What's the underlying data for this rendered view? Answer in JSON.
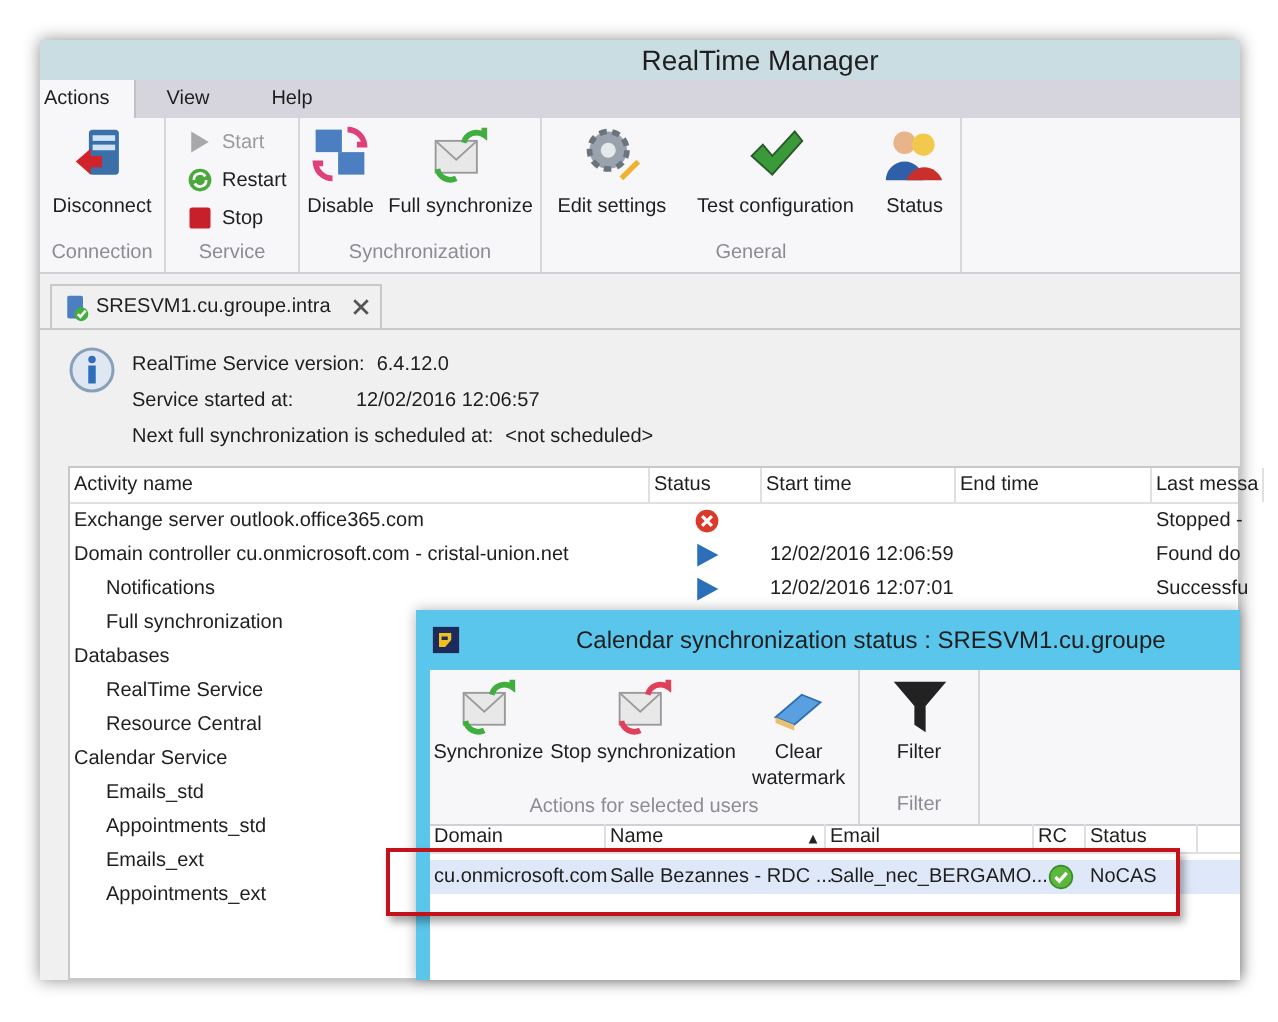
{
  "window": {
    "title": "RealTime Manager"
  },
  "menu_tabs": [
    {
      "label": "Actions",
      "selected": true
    },
    {
      "label": "View",
      "selected": false
    },
    {
      "label": "Help",
      "selected": false
    }
  ],
  "ribbon_groups": [
    {
      "label": "Connection",
      "buttons": [
        {
          "label": "Disconnect",
          "kind": "large",
          "disabled": false
        }
      ]
    },
    {
      "label": "Service",
      "buttons": [
        {
          "label": "Start",
          "kind": "small",
          "disabled": true
        },
        {
          "label": "Restart",
          "kind": "small",
          "disabled": false
        },
        {
          "label": "Stop",
          "kind": "small",
          "disabled": false
        }
      ]
    },
    {
      "label": "Synchronization",
      "buttons": [
        {
          "label": "Disable",
          "kind": "large",
          "disabled": false
        },
        {
          "label": "Full synchronize",
          "kind": "large",
          "disabled": false
        }
      ]
    },
    {
      "label": "General",
      "buttons": [
        {
          "label": "Edit settings",
          "kind": "large",
          "disabled": false
        },
        {
          "label": "Test configuration",
          "kind": "large",
          "disabled": false
        },
        {
          "label": "Status",
          "kind": "large",
          "disabled": false
        }
      ]
    }
  ],
  "document_tab": {
    "label": "SRESVM1.cu.groupe.intra",
    "selected": true
  },
  "info": [
    {
      "label": "RealTime Service version:",
      "value": "6.4.12.0"
    },
    {
      "label": "Service started at:",
      "value": "12/02/2016 12:06:57"
    },
    {
      "label": "Next full synchronization is scheduled at:",
      "value": "<not scheduled>"
    }
  ],
  "activity_table": {
    "columns": [
      "Activity name",
      "Status",
      "Start time",
      "End time",
      "Last messa"
    ],
    "rows": [
      {
        "name": "Exchange server outlook.office365.com",
        "kind": "error",
        "last_message": "Stopped -"
      },
      {
        "name": "Domain controller cu.onmicrosoft.com - cristal-union.net",
        "kind": "running",
        "start_time": "12/02/2016 12:06:59",
        "last_message": "Found do",
        "children": [
          {
            "name": "Notifications",
            "kind": "running",
            "start_time": "12/02/2016 12:07:01",
            "last_message": "Successfu"
          },
          {
            "name": "Full synchronization"
          }
        ]
      },
      {
        "name": "Databases",
        "children": [
          {
            "name": "RealTime Service"
          },
          {
            "name": "Resource Central"
          }
        ]
      },
      {
        "name": "Calendar Service",
        "children": [
          {
            "name": "Emails_std"
          },
          {
            "name": "Appointments_std"
          },
          {
            "name": "Emails_ext"
          },
          {
            "name": "Appointments_ext"
          }
        ]
      }
    ]
  },
  "calendar_window": {
    "title": "Calendar synchronization status : SRESVM1.cu.groupe",
    "ribbon_groups": [
      {
        "label": "Actions for selected users",
        "buttons": [
          "Synchronize",
          "Stop synchronization",
          "Clear watermark"
        ]
      },
      {
        "label": "Filter",
        "buttons": [
          "Filter"
        ]
      }
    ],
    "table": {
      "columns": [
        {
          "label": "Domain",
          "sorted": false
        },
        {
          "label": "Name",
          "sorted": true
        },
        {
          "label": "Email",
          "sorted": false
        },
        {
          "label": "RC",
          "sorted": false
        },
        {
          "label": "Status",
          "sorted": false
        }
      ],
      "rows": [
        {
          "domain": "cu.onmicrosoft.com",
          "name": "Salle Bezannes - RDC ...",
          "email": "Salle_nec_BERGAMO...",
          "rc_ok": true,
          "status": "NoCAS",
          "selected": true
        }
      ]
    }
  }
}
